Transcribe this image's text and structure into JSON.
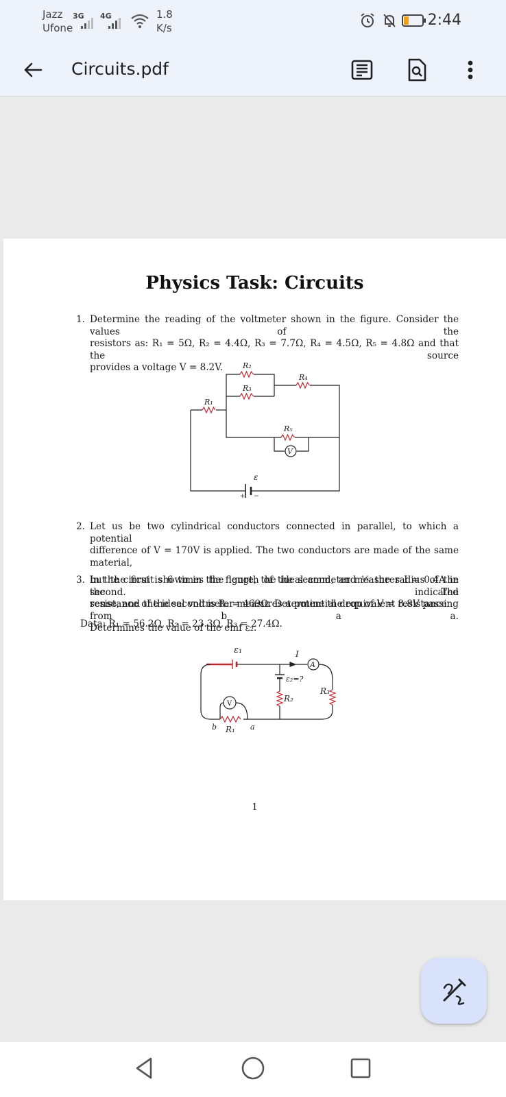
{
  "status_bar": {
    "carrier1": "Jazz",
    "carrier2": "Ufone",
    "net1": "3G",
    "net2": "4G",
    "speed_value": "1.8",
    "speed_unit": "K/s",
    "time": "2:44"
  },
  "toolbar": {
    "file_name": "Circuits.pdf",
    "icons": [
      "back-arrow-icon",
      "reading-mode-icon",
      "search-document-icon",
      "more-vert-icon"
    ]
  },
  "document": {
    "title": "Physics Task: Circuits",
    "q1": {
      "number": "1.",
      "lines": [
        "Determine the reading of the voltmeter shown in the figure. Consider the values of the",
        "resistors as: R₁ = 5Ω, R₂ = 4.4Ω, R₃ = 7.7Ω, R₄ = 4.5Ω, R₅ = 4.8Ω and that the source",
        "provides a voltage V = 8.2V."
      ]
    },
    "fig1": {
      "R1": "R₁",
      "R2": "R₂",
      "R3": "R₃",
      "R4": "R₄",
      "R5": "R₅",
      "V": "V",
      "emf": "ε",
      "plus": "+",
      "minus": "−"
    },
    "q2": {
      "number": "2.",
      "lines": [
        "Let us be two cylindrical conductors connected in parallel, to which a potential",
        "difference of V = 170V is applied. The two conductors are made of the same material,",
        "but the first is 6 times the length of the second, and ⅕ the radius of the second. The",
        "resistance of the second is R₂ = 469Ω. Determine the equivalent resistance."
      ]
    },
    "q3": {
      "number": "3.",
      "lines": [
        "In the circuit shown in the figure, the ideal ammeter measures I = 0.4A in the indicated",
        "sense, and the ideal voltmeter measures a potential drop of V = 8.8V passing from b a a.",
        "Determines the value of the emf ε₂."
      ]
    },
    "data_line": "Data: R₁ = 56.2Ω, R₂ = 23.3Ω, R₃ = 27.4Ω.",
    "fig2": {
      "e1": "ε₁",
      "I": "I",
      "A": "A",
      "e2": "ε₂=?",
      "R3": "R₃",
      "V": "V",
      "R2": "R₂",
      "b": "b",
      "R1": "R₁",
      "a": "a"
    },
    "page_number": "1"
  },
  "fab": {
    "icon": "edit-annotate-icon"
  },
  "nav": {
    "icons": [
      "back-triangle-icon",
      "home-circle-icon",
      "recents-square-icon"
    ]
  },
  "colors": {
    "topbar_bg": "#eef2fb",
    "fab_bg": "#d8e3fb",
    "page_bg": "#ffffff",
    "viewer_bg": "#eaeaea"
  }
}
